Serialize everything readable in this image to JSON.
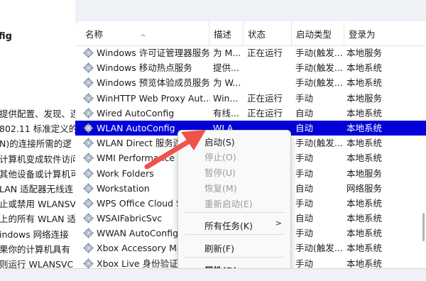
{
  "left": {
    "title": "fig",
    "description_lines": [
      "提供配置、发现、连",
      "802.11 标准定义的",
      "N)的连接所需的逻",
      "计算机变成软件访问",
      "其他设备或计算机可",
      "LAN 适配器无线连",
      "止或禁用 WLANSVC",
      "上的所有 WLAN 适",
      "indows 网络连接",
      "果你的计算机具有",
      "则运行 WLANSVC"
    ]
  },
  "table": {
    "columns": [
      "名称",
      "描述",
      "状态",
      "启动类型",
      "登录为"
    ],
    "sort_icon": "^",
    "rows": [
      {
        "name": "Windows 许可证管理器服务",
        "desc": "为 M...",
        "status": "正在运行",
        "type": "手动(触发...",
        "logon": "本地服务",
        "selected": false
      },
      {
        "name": "Windows 移动热点服务",
        "desc": "提供...",
        "status": "",
        "type": "手动(触发...",
        "logon": "本地系统",
        "selected": false
      },
      {
        "name": "Windows 预览体验成员服务",
        "desc": "为 W...",
        "status": "",
        "type": "手动(触发...",
        "logon": "本地系统",
        "selected": false
      },
      {
        "name": "WinHTTP Web Proxy Aut...",
        "desc": "Win...",
        "status": "正在运行",
        "type": "手动",
        "logon": "本地服务",
        "selected": false
      },
      {
        "name": "Wired AutoConfig",
        "desc": "有线...",
        "status": "正在运行",
        "type": "自动",
        "logon": "本地系统",
        "selected": false
      },
      {
        "name": "WLAN AutoConfig",
        "desc": "WLA...",
        "status": "",
        "type": "自动",
        "logon": "本地系统",
        "selected": true
      },
      {
        "name": "WLAN Direct 服务连",
        "desc": "",
        "status": "",
        "type": "手动(触发...",
        "logon": "本地系统",
        "selected": false
      },
      {
        "name": "WMI Performance A",
        "desc": "",
        "status": "",
        "type": "手动",
        "logon": "本地系统",
        "selected": false
      },
      {
        "name": "Work Folders",
        "desc": "",
        "status": "",
        "type": "手动",
        "logon": "本地服务",
        "selected": false
      },
      {
        "name": "Workstation",
        "desc": "",
        "status": "",
        "type": "自动",
        "logon": "网络服务",
        "selected": false
      },
      {
        "name": "WPS Office Cloud S",
        "desc": "",
        "status": "",
        "type": "手动",
        "logon": "本地系统",
        "selected": false
      },
      {
        "name": "WSAIFabricSvc",
        "desc": "",
        "status": "",
        "type": "自动",
        "logon": "本地系统",
        "selected": false
      },
      {
        "name": "WWAN AutoConfig",
        "desc": "",
        "status": "",
        "type": "手动",
        "logon": "本地系统",
        "selected": false
      },
      {
        "name": "Xbox Accessory Ma",
        "desc": "",
        "status": "",
        "type": "手动(触发...",
        "logon": "本地系统",
        "selected": false
      },
      {
        "name": "Xbox Live 身份验证管",
        "desc": "",
        "status": "",
        "type": "手动",
        "logon": "本地系统",
        "selected": false
      }
    ]
  },
  "context_menu": {
    "start": "启动(S)",
    "stop": "停止(O)",
    "pause": "暂停(U)",
    "resume": "恢复(M)",
    "restart": "重新启动(E)",
    "all_tasks": "所有任务(K)",
    "refresh": "刷新(F)",
    "properties": "属性(R)",
    "submenu_arrow": ">"
  },
  "colors": {
    "selection": "#0202d8",
    "annotation_arrow": "#f0524a"
  }
}
